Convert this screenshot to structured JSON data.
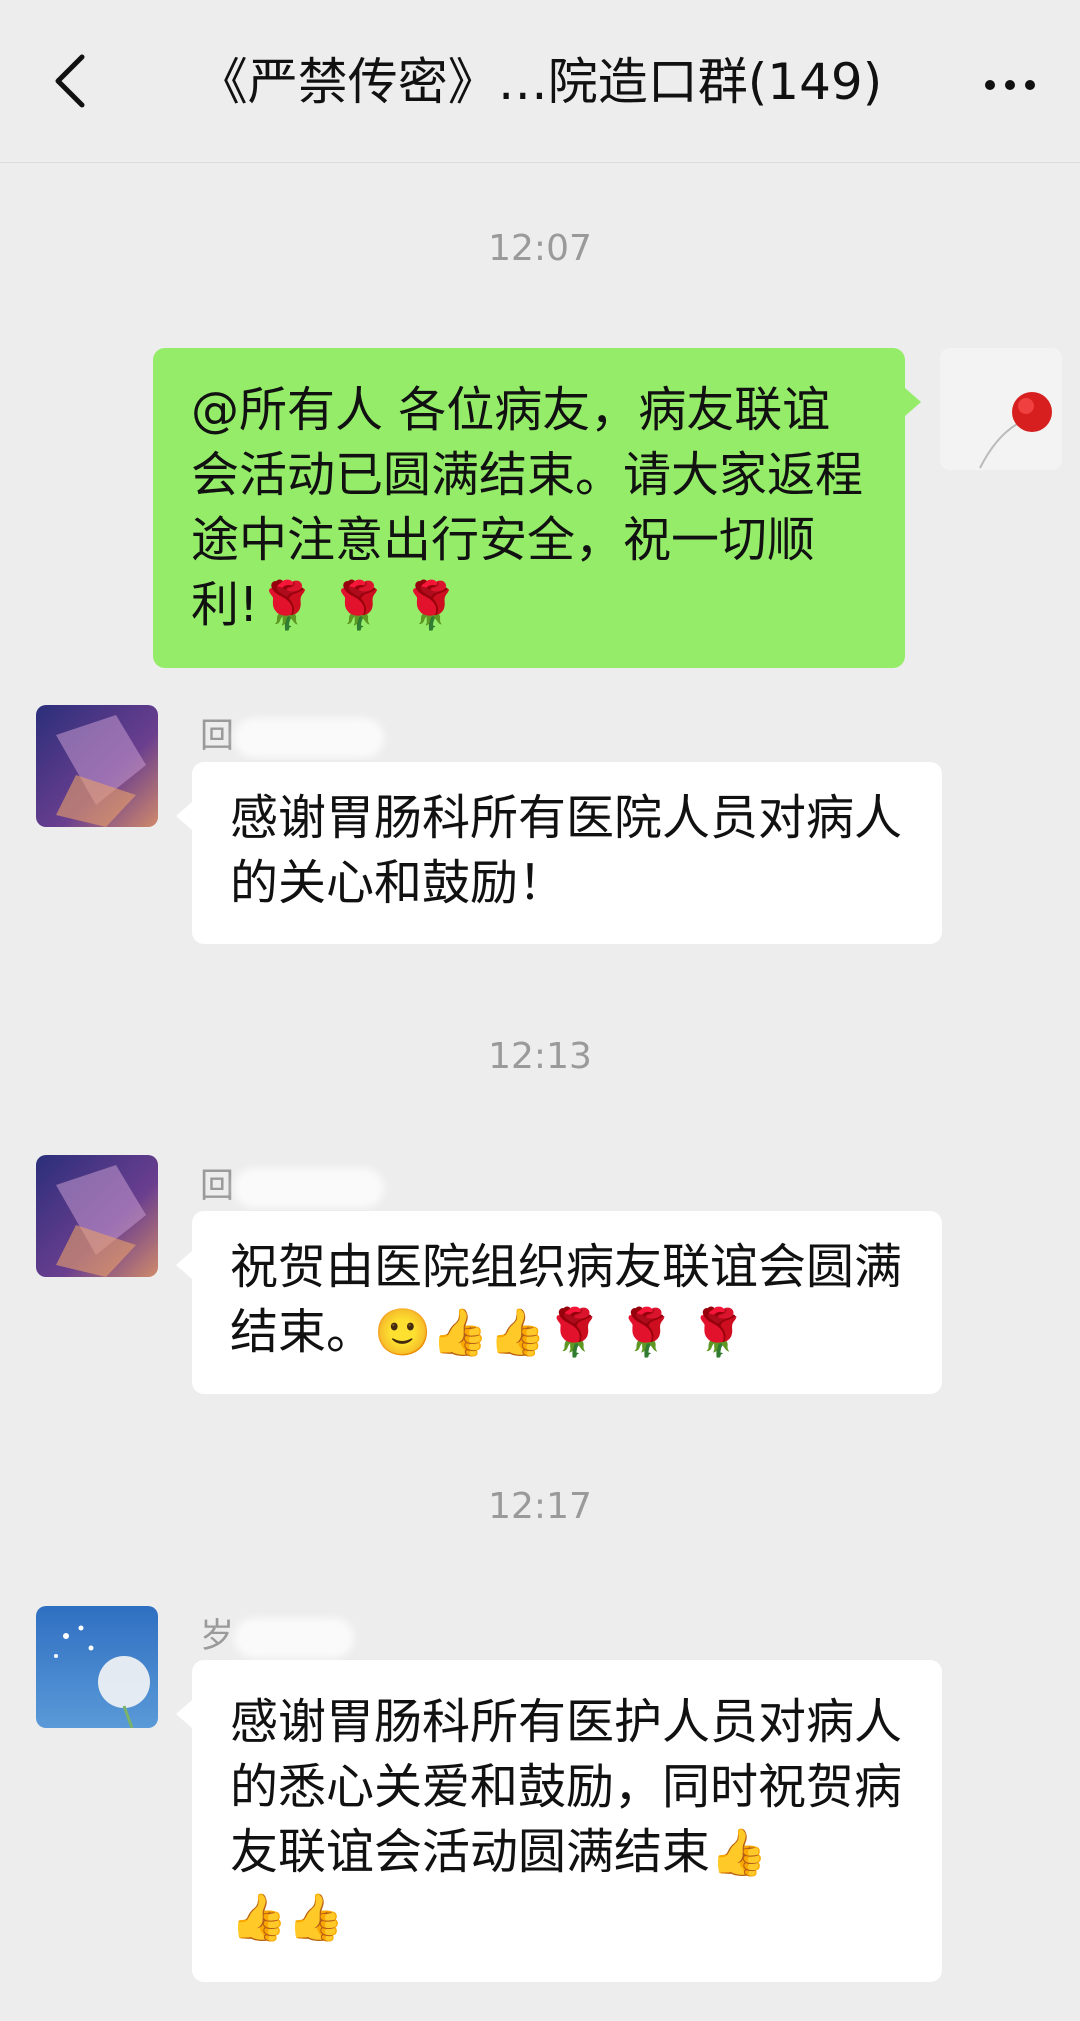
{
  "header": {
    "title": "《严禁传密》…院造口群(149)"
  },
  "messages": [
    {
      "time": "12:07"
    },
    {
      "sender": "me",
      "text": "@所有人 各位病友，病友联谊会活动已圆满结束。请大家返程途中注意出行安全，祝一切顺利!",
      "emoji": "🌹 🌹 🌹"
    },
    {
      "sender_name": "回",
      "text": "感谢胃肠科所有医院人员对病人的关心和鼓励！"
    },
    {
      "time": "12:13"
    },
    {
      "sender_name": "回",
      "text": "祝贺由医院组织病友联谊会圆满结束。",
      "emoji": "🙂👍👍🌹 🌹 🌹"
    },
    {
      "time": "12:17"
    },
    {
      "sender_name": "岁",
      "text": "感谢胃肠科所有医护人员对病人的悉心关爱和鼓励，同时祝贺病友联谊会活动圆满结束",
      "emoji_inline": "👍",
      "emoji_tail": "👍👍"
    }
  ],
  "colors": {
    "background": "#ededed",
    "own_bubble": "#95ec69",
    "other_bubble": "#ffffff",
    "timestamp": "#9a9a9a"
  },
  "icons": [
    "back-chevron-icon",
    "more-dots-icon",
    "avatar-dandelion",
    "avatar-abstract-purple",
    "avatar-red-flower"
  ]
}
